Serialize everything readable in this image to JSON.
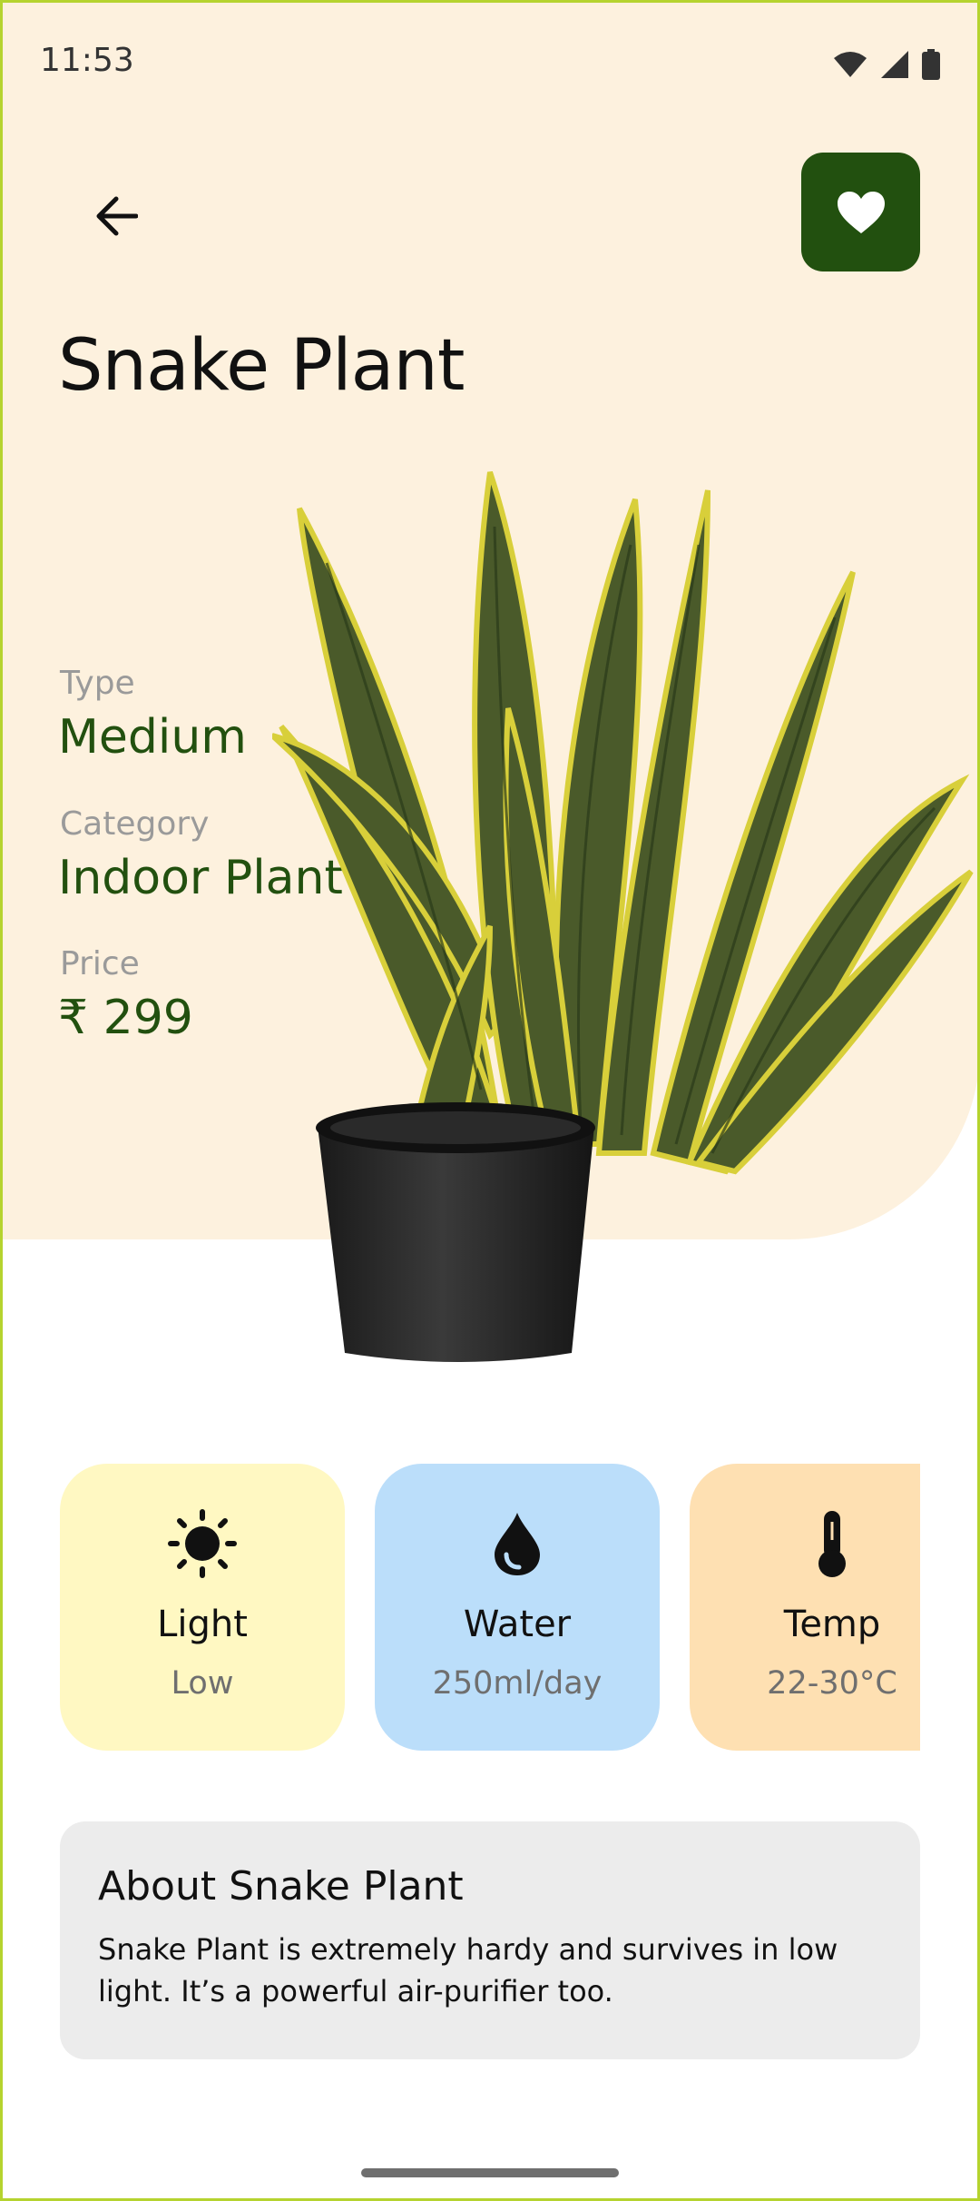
{
  "status_bar": {
    "time": "11:53",
    "icons": [
      "wifi-icon",
      "signal-icon",
      "battery-icon"
    ]
  },
  "header": {
    "back_icon": "arrow-left-icon",
    "favorite_icon": "heart-icon",
    "favorite_color": "#22500f"
  },
  "plant": {
    "name": "Snake Plant",
    "type_label": "Type",
    "type_value": "Medium",
    "category_label": "Category",
    "category_value": "Indoor Plant",
    "price_label": "Price",
    "price_value": "₹ 299"
  },
  "care_cards": [
    {
      "icon": "sun-icon",
      "title": "Light",
      "value": "Low",
      "color": "#fff8c2"
    },
    {
      "icon": "water-drop-icon",
      "title": "Water",
      "value": "250ml/day",
      "color": "#bbdefa"
    },
    {
      "icon": "thermometer-icon",
      "title": "Temp",
      "value": "22-30°C",
      "color": "#fee0b2"
    }
  ],
  "about": {
    "title": "About Snake Plant",
    "text": "Snake Plant is extremely hardy and survives in low light. It’s a powerful air-purifier too."
  },
  "colors": {
    "hero_background": "#fdf1de",
    "accent": "#22500f"
  }
}
